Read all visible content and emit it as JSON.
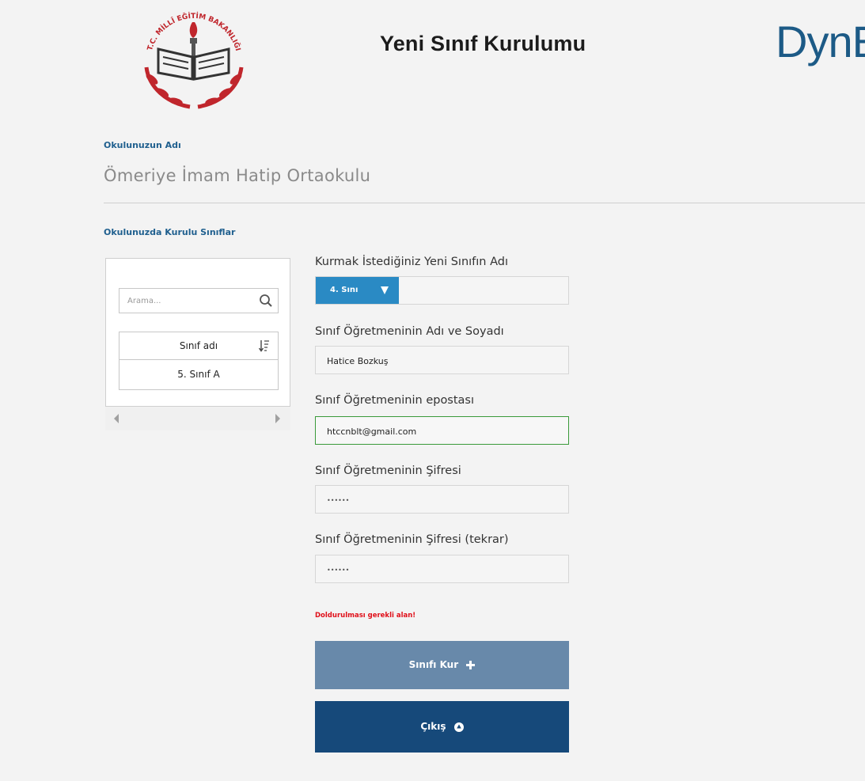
{
  "header": {
    "title": "Yeni Sınıf Kurulumu",
    "brand": "DynE",
    "logo_text": "T.C. MİLLÎ EĞİTİM BAKANLIĞI"
  },
  "school": {
    "label": "Okulunuzun Adı",
    "name": "Ömeriye İmam Hatip Ortaokulu"
  },
  "classes_panel": {
    "label": "Okulunuzda Kurulu Sınıflar",
    "search_placeholder": "Arama...",
    "column_header": "Sınıf adı",
    "rows": [
      "5. Sınıf A"
    ]
  },
  "form": {
    "class_name_label": "Kurmak İstediğiniz Yeni Sınıfın Adı",
    "class_name_value": "4. Sını",
    "teacher_name_label": "Sınıf Öğretmeninin Adı ve Soyadı",
    "teacher_name_value": "Hatice Bozkuş",
    "email_label": "Sınıf Öğretmeninin epostası",
    "email_value": "htccnblt@gmail.com",
    "password_label": "Sınıf Öğretmeninin Şifresi",
    "password_value": "••••••",
    "password_repeat_label": "Sınıf Öğretmeninin Şifresi (tekrar)",
    "password_repeat_value": "••••••",
    "error": "Doldurulması gerekli alan!"
  },
  "buttons": {
    "create": "Sınıfı Kur",
    "exit": "Çıkış"
  },
  "colors": {
    "accent": "#2a8ac4",
    "label_blue": "#1f5f8e",
    "error": "#e0101a",
    "create_button": "#6889aa",
    "exit_button": "#16497a",
    "focus_border": "#3a9a3a"
  }
}
